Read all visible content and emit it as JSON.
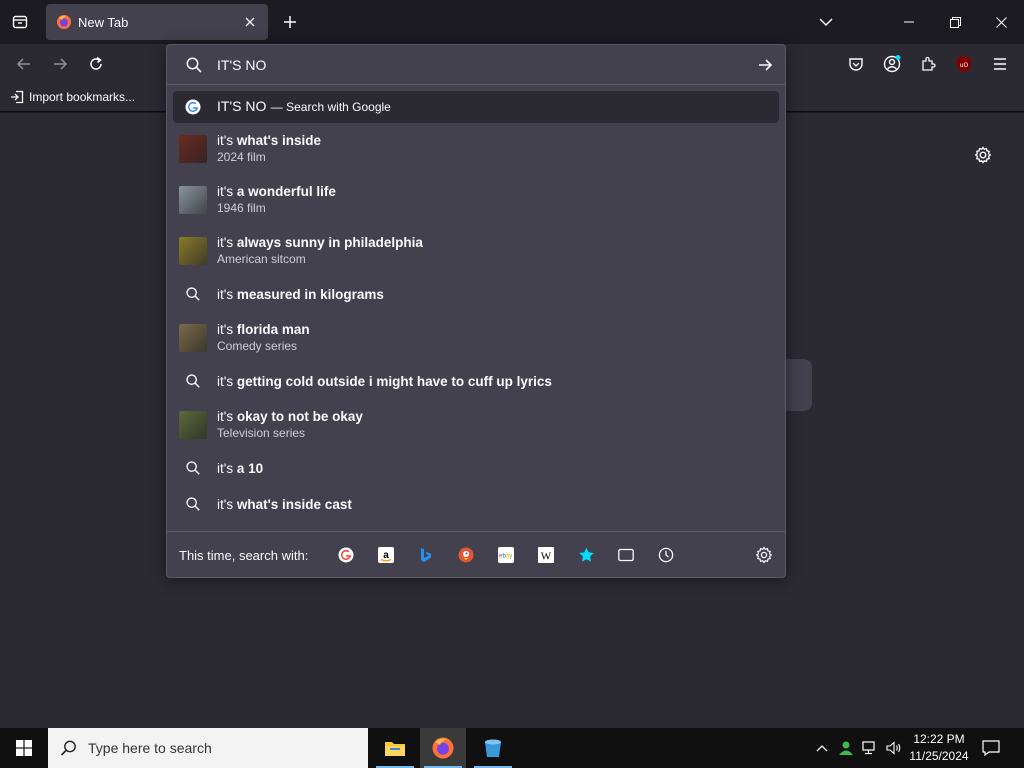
{
  "browser": {
    "tab": {
      "title": "New Tab",
      "favicon": "firefox-icon"
    },
    "bookmarks_bar": {
      "import_label": "Import bookmarks..."
    }
  },
  "urlbar": {
    "query": "IT'S NO",
    "heuristic": {
      "query": "IT'S NO",
      "action": "— Search with Google"
    },
    "results": [
      {
        "type": "entity",
        "prefix": "it's ",
        "bold": "what's inside",
        "sub": "2024 film",
        "thumb_color": "#6b2a22"
      },
      {
        "type": "entity",
        "prefix": "it's ",
        "bold": "a wonderful life",
        "sub": "1946 film",
        "thumb_color": "#8b95a0"
      },
      {
        "type": "entity",
        "prefix": "it's ",
        "bold": "always sunny in philadelphia",
        "sub": "American sitcom",
        "thumb_color": "#8a7a2a"
      },
      {
        "type": "search",
        "prefix": "it's ",
        "bold": "measured in kilograms"
      },
      {
        "type": "entity",
        "prefix": "it's ",
        "bold": "florida man",
        "sub": "Comedy series",
        "thumb_color": "#7a6a4a"
      },
      {
        "type": "search",
        "prefix": "it's ",
        "bold": "getting cold outside i might have to cuff up lyrics"
      },
      {
        "type": "entity",
        "prefix": "it's ",
        "bold": "okay to not be okay",
        "sub": "Television series",
        "thumb_color": "#5b6a3a"
      },
      {
        "type": "search",
        "prefix": "it's ",
        "bold": "a 10"
      },
      {
        "type": "search",
        "prefix": "it's ",
        "bold": "what's inside cast"
      }
    ],
    "one_off": {
      "label": "This time, search with:",
      "engines": [
        "google-icon",
        "amazon-icon",
        "bing-icon",
        "duckduckgo-icon",
        "ebay-icon",
        "wikipedia-icon",
        "bookmarks-star-icon",
        "tabs-icon",
        "history-icon"
      ]
    }
  },
  "taskbar": {
    "search_placeholder": "Type here to search",
    "time": "12:22 PM",
    "date": "11/25/2024"
  },
  "colors": {
    "page_bg": "#2b2a33",
    "popup_bg": "#42414d",
    "heuristic_bg": "#2b2a33",
    "accent": "#00ddff"
  }
}
